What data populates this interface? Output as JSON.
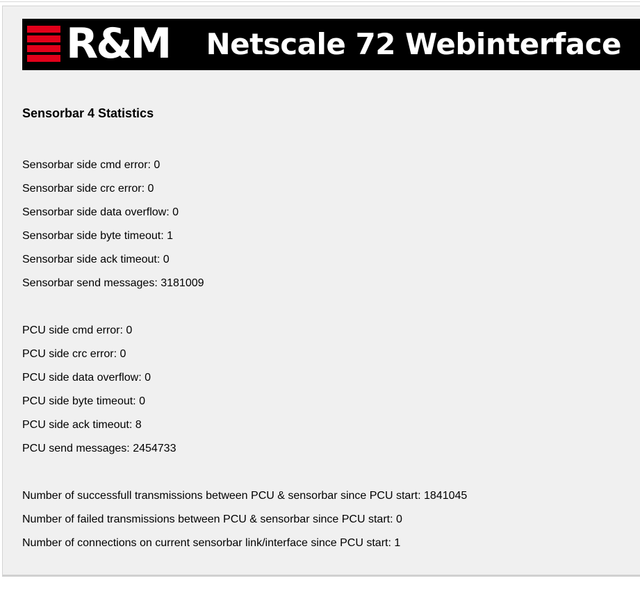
{
  "header": {
    "logo_text": "R&M",
    "title": "Netscale 72 Webinterface",
    "brand_color": "#e2001a"
  },
  "section": {
    "title": "Sensorbar 4 Statistics"
  },
  "sensorbar_stats": [
    {
      "label": "Sensorbar side cmd error:",
      "value": "0"
    },
    {
      "label": "Sensorbar side crc error:",
      "value": "0"
    },
    {
      "label": "Sensorbar side data overflow:",
      "value": "0"
    },
    {
      "label": "Sensorbar side byte timeout:",
      "value": "1"
    },
    {
      "label": "Sensorbar side ack timeout:",
      "value": "0"
    },
    {
      "label": "Sensorbar send messages:",
      "value": "3181009"
    }
  ],
  "pcu_stats": [
    {
      "label": "PCU side cmd error:",
      "value": "0"
    },
    {
      "label": "PCU side crc error:",
      "value": "0"
    },
    {
      "label": "PCU side data overflow:",
      "value": "0"
    },
    {
      "label": "PCU side byte timeout:",
      "value": "0"
    },
    {
      "label": "PCU side ack timeout:",
      "value": "8"
    },
    {
      "label": "PCU send messages:",
      "value": "2454733"
    }
  ],
  "transmission_stats": [
    {
      "label": "Number of successfull transmissions between PCU & sensorbar since PCU start:",
      "value": "1841045"
    },
    {
      "label": "Number of failed transmissions between PCU & sensorbar since PCU start:",
      "value": "0"
    },
    {
      "label": "Number of connections on current sensorbar link/interface since PCU start:",
      "value": "1"
    }
  ]
}
